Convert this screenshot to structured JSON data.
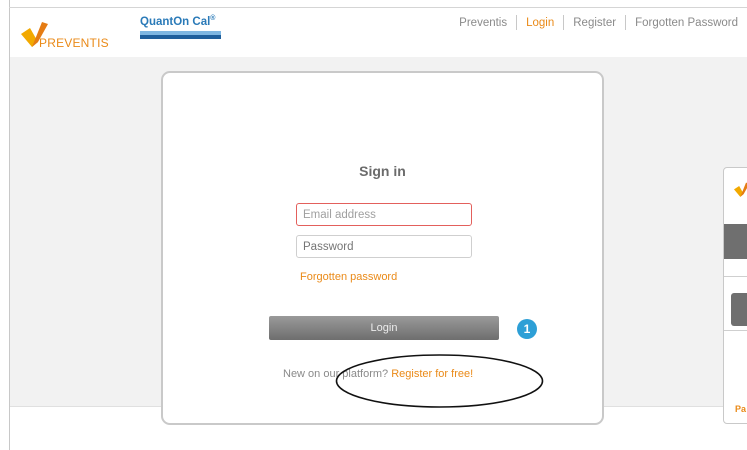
{
  "brand": {
    "logo_text": "PREVENTIS",
    "product_name": "QuantOn Cal",
    "product_mark": "®"
  },
  "nav": {
    "items": [
      {
        "label": "Preventis",
        "active": false
      },
      {
        "label": "Login",
        "active": true
      },
      {
        "label": "Register",
        "active": false
      },
      {
        "label": "Forgotten Password",
        "active": false
      }
    ]
  },
  "signin": {
    "title": "Sign in",
    "email_placeholder": "Email address",
    "password_placeholder": "Password",
    "forgot_label": "Forgotten password",
    "login_label": "Login",
    "new_text": "New on our platform?",
    "register_label": "Register for free!"
  },
  "annotation": {
    "badge": "1"
  },
  "preview": {
    "text": "Pa"
  },
  "colors": {
    "accent_orange": "#ea8a18",
    "product_blue": "#2a7ab8",
    "badge_blue": "#2d9fd6",
    "error_border": "#e3605c",
    "button_gray": "#7a7a7a",
    "background_gray": "#f2f2f2"
  }
}
